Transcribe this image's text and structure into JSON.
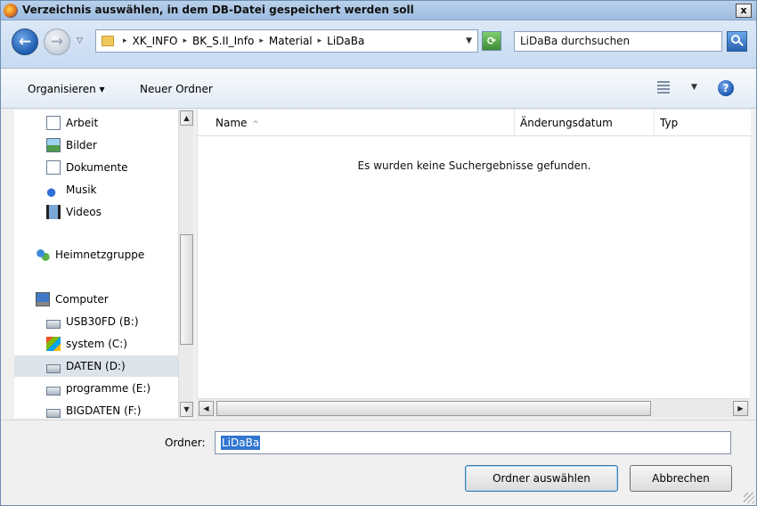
{
  "window": {
    "title": "Verzeichnis auswählen, in dem DB-Datei gespeichert werden soll",
    "close_label": "x"
  },
  "address": {
    "breadcrumbs": [
      "XK_INFO",
      "BK_S.II_Info",
      "Material",
      "LiDaBa"
    ],
    "search_placeholder": "LiDaBa durchsuchen"
  },
  "toolbar": {
    "organize_label": "Organisieren ▾",
    "new_folder_label": "Neuer Ordner",
    "help_label": "?"
  },
  "nav": {
    "items": [
      {
        "label": "Arbeit",
        "icon": "document-icon"
      },
      {
        "label": "Bilder",
        "icon": "pictures-icon"
      },
      {
        "label": "Dokumente",
        "icon": "document-icon"
      },
      {
        "label": "Musik",
        "icon": "music-icon"
      },
      {
        "label": "Videos",
        "icon": "video-icon"
      },
      {
        "label": "Heimnetzgruppe",
        "icon": "homegroup-icon"
      },
      {
        "label": "Computer",
        "icon": "computer-icon"
      },
      {
        "label": "USB30FD (B:)",
        "icon": "drive-icon"
      },
      {
        "label": "system (C:)",
        "icon": "system-drive-icon"
      },
      {
        "label": "DATEN (D:)",
        "icon": "drive-icon",
        "selected": true
      },
      {
        "label": "programme (E:)",
        "icon": "drive-icon"
      },
      {
        "label": "BIGDATEN (F:)",
        "icon": "drive-icon"
      }
    ]
  },
  "list": {
    "columns": [
      "Name",
      "Änderungsdatum",
      "Typ"
    ],
    "empty_message": "Es wurden keine Suchergebnisse gefunden."
  },
  "footer": {
    "folder_label": "Ordner:",
    "folder_value": "LiDaBa",
    "select_button": "Ordner auswählen",
    "cancel_button": "Abbrechen"
  }
}
